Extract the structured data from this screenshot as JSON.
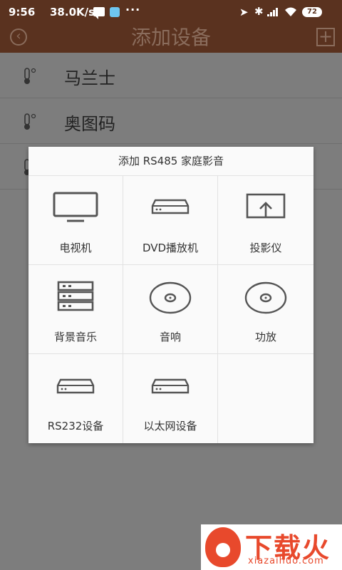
{
  "status": {
    "time": "9:56",
    "speed": "38.0K/s",
    "dots": "···",
    "battery": "72"
  },
  "header": {
    "back_icon": "back-circle-icon",
    "title": "添加设备",
    "add_icon": "plus-square-icon"
  },
  "devices": [
    {
      "name": "马兰士",
      "icon": "thermometer-icon"
    },
    {
      "name": "奥图码",
      "icon": "thermometer-icon"
    }
  ],
  "dialog": {
    "title": "添加 RS485 家庭影音",
    "items": [
      {
        "label": "电视机",
        "icon": "tv-icon"
      },
      {
        "label": "DVD播放机",
        "icon": "dvd-player-icon"
      },
      {
        "label": "投影仪",
        "icon": "projector-icon"
      },
      {
        "label": "背景音乐",
        "icon": "server-rack-icon"
      },
      {
        "label": "音响",
        "icon": "disc-icon"
      },
      {
        "label": "功放",
        "icon": "disc-icon"
      },
      {
        "label": "RS232设备",
        "icon": "device-box-icon"
      },
      {
        "label": "以太网设备",
        "icon": "device-box-icon"
      }
    ]
  },
  "watermark": {
    "title": "下载火",
    "subtitle": "xiazaihuo.com"
  },
  "colors": {
    "header": "#5a321f",
    "overlay": "#7d7d7d",
    "dialog": "#fafafa",
    "watermark": "#e8492c"
  }
}
